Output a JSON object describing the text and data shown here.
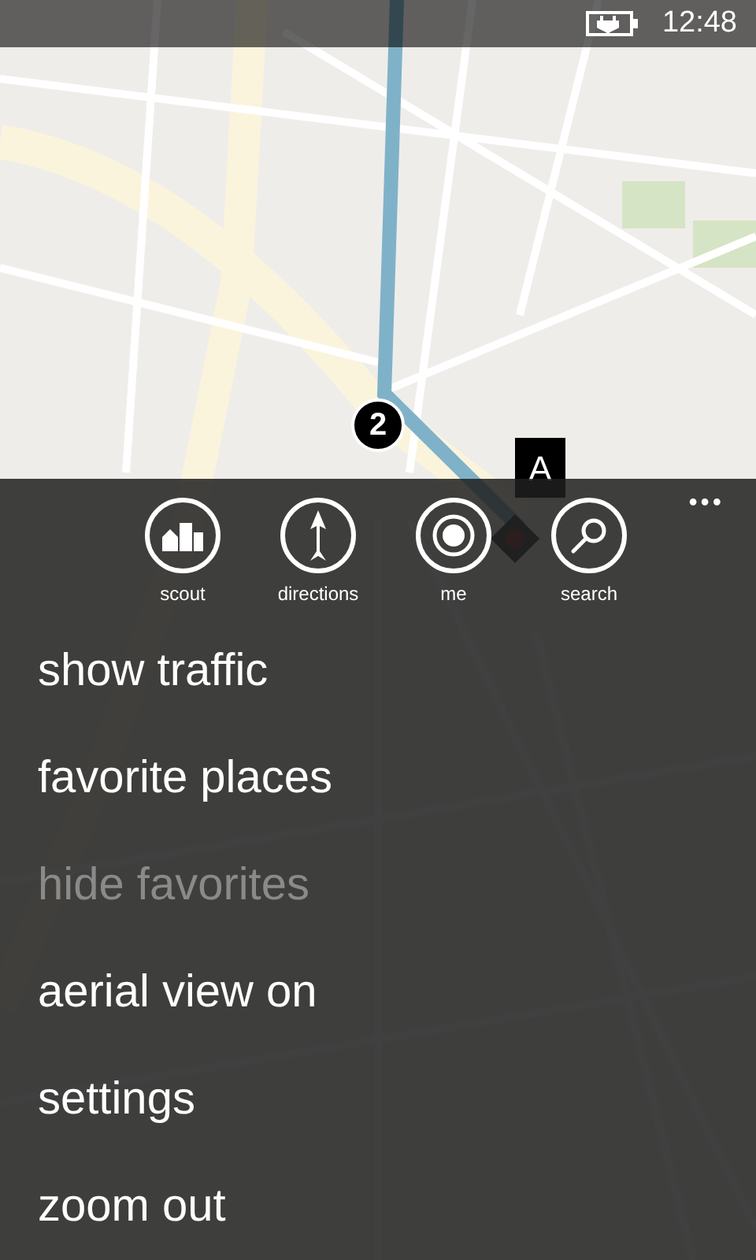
{
  "status_bar": {
    "time": "12:48"
  },
  "map": {
    "pins": [
      {
        "kind": "waypoint",
        "label": "2"
      },
      {
        "kind": "destination",
        "label": "A"
      }
    ]
  },
  "app_bar": {
    "more": "•••",
    "buttons": [
      {
        "kind": "scout",
        "label": "scout"
      },
      {
        "kind": "directions",
        "label": "directions"
      },
      {
        "kind": "me",
        "label": "me"
      },
      {
        "kind": "search",
        "label": "search"
      }
    ]
  },
  "menu": [
    {
      "label": "show traffic",
      "disabled": false
    },
    {
      "label": "favorite places",
      "disabled": false
    },
    {
      "label": "hide favorites",
      "disabled": true
    },
    {
      "label": "aerial view on",
      "disabled": false
    },
    {
      "label": "settings",
      "disabled": false
    },
    {
      "label": "zoom out",
      "disabled": false
    }
  ]
}
